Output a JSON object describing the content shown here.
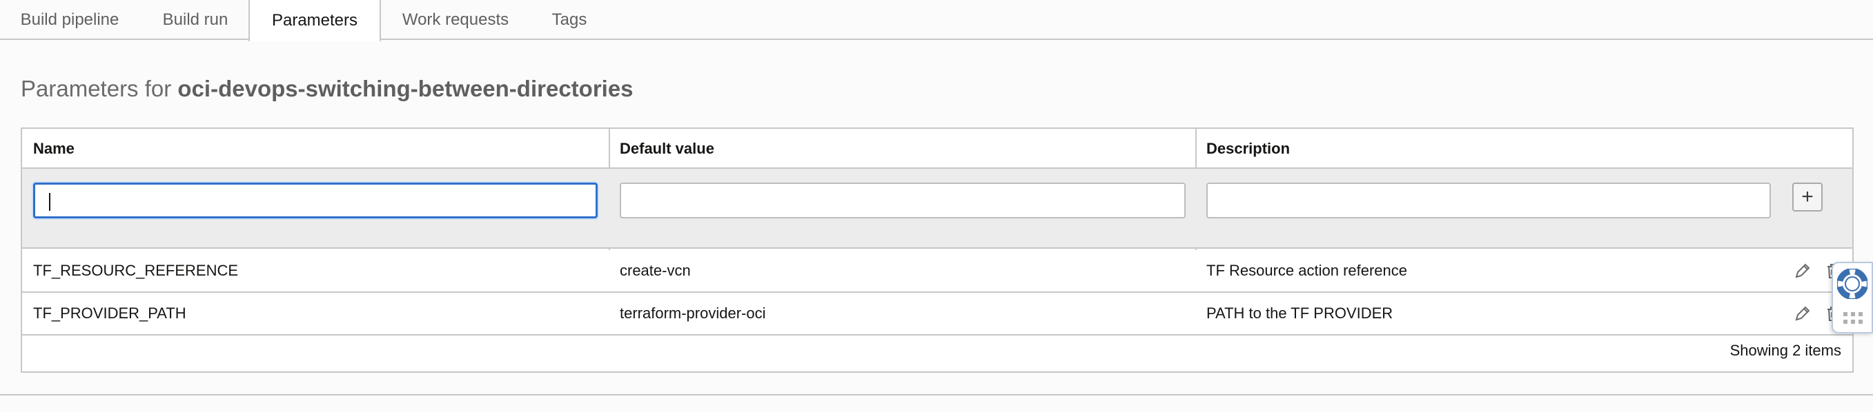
{
  "tabs": [
    {
      "label": "Build pipeline",
      "active": false
    },
    {
      "label": "Build run",
      "active": false
    },
    {
      "label": "Parameters",
      "active": true
    },
    {
      "label": "Work requests",
      "active": false
    },
    {
      "label": "Tags",
      "active": false
    }
  ],
  "heading": {
    "prefix": "Parameters for ",
    "pipeline_name": "oci-devops-switching-between-directories"
  },
  "table": {
    "columns": [
      "Name",
      "Default value",
      "Description"
    ],
    "new_row": {
      "name_value": "",
      "default_value": "",
      "description_value": "",
      "add_label": "+"
    },
    "rows": [
      {
        "name": "TF_RESOURC_REFERENCE",
        "default_value": "create-vcn",
        "description": "TF Resource action reference"
      },
      {
        "name": "TF_PROVIDER_PATH",
        "default_value": "terraform-provider-oci",
        "description": "PATH to the TF PROVIDER"
      }
    ],
    "footer": "Showing 2 items"
  },
  "icons": {
    "edit": "pencil-icon",
    "delete": "trash-icon",
    "help": "lifebuoy-icon",
    "grip": "grid-dots-icon"
  },
  "colors": {
    "focus": "#2f6fca",
    "help": "#3a6fb0",
    "border": "#c7c7c7"
  }
}
